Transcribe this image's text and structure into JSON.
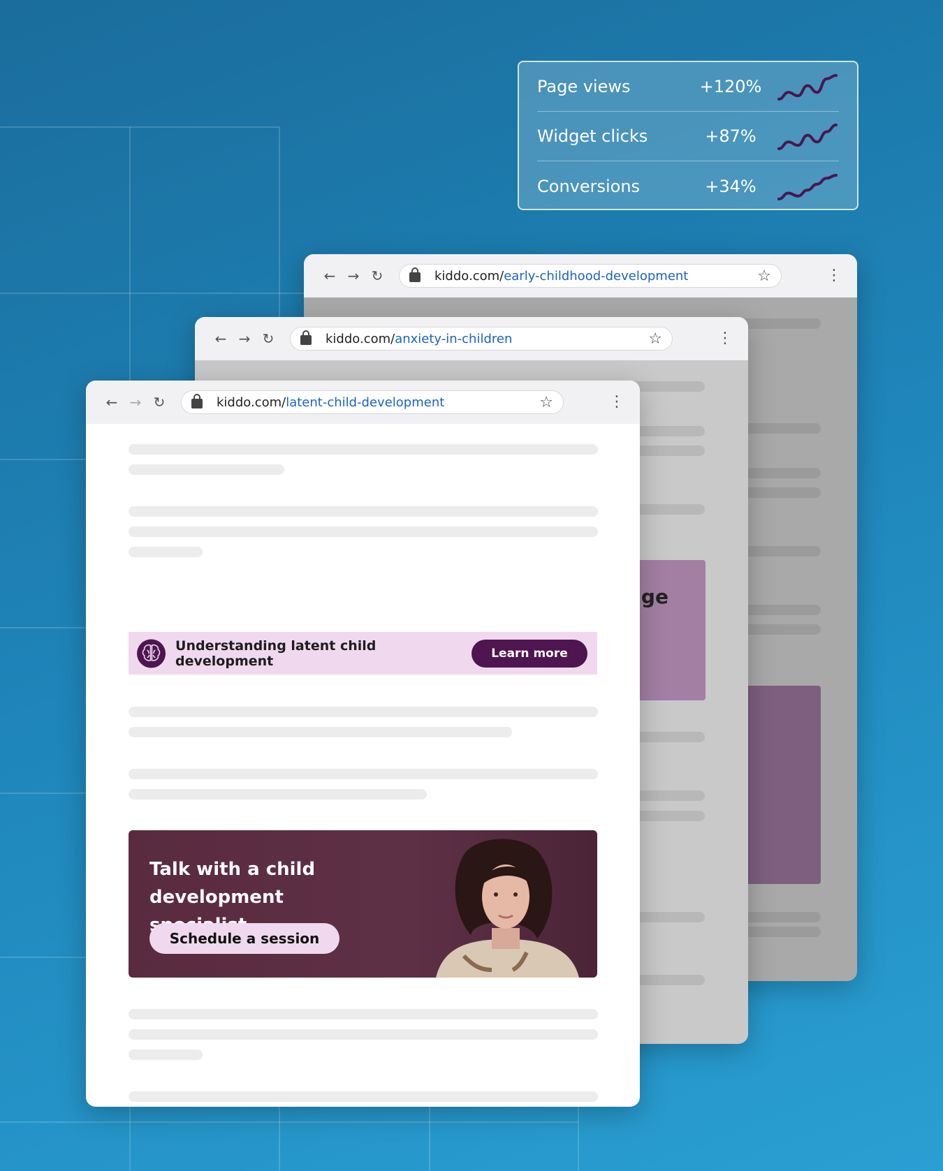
{
  "stats": [
    {
      "label": "Page views",
      "value": "+120%",
      "trend": [
        2,
        4,
        3,
        6,
        4,
        8,
        9
      ]
    },
    {
      "label": "Widget clicks",
      "value": "+87%",
      "trend": [
        2,
        4,
        3,
        6,
        4,
        7,
        9
      ]
    },
    {
      "label": "Conversions",
      "value": "+34%",
      "trend": [
        1,
        3,
        2,
        4,
        6,
        8,
        9
      ]
    }
  ],
  "browsers": {
    "back": {
      "domain": "kiddo.com/",
      "path": "early-childhood-development"
    },
    "middle": {
      "domain": "kiddo.com/",
      "path": "anxiety-in-children",
      "promo_fragment": "age"
    },
    "front": {
      "domain": "kiddo.com/",
      "path": "latent-child-development"
    }
  },
  "banner": {
    "icon": "brain-icon",
    "text": "Understanding latent child development",
    "button": "Learn more"
  },
  "ad": {
    "headline": "Talk with a child development specialist",
    "button": "Schedule a session"
  },
  "colors": {
    "accent": "#4f1550",
    "banner_bg": "#f0d9ef",
    "ad_bg": "#5a2b3f",
    "link": "#1a63c7",
    "sparkline": "#4a1650"
  }
}
